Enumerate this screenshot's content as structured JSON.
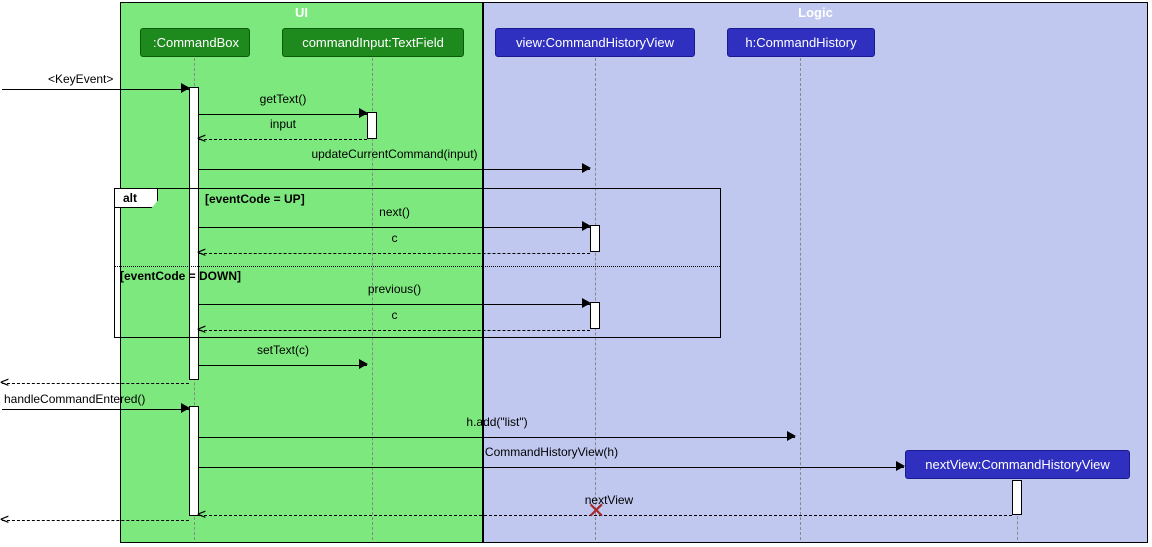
{
  "regions": {
    "ui": {
      "label": "UI"
    },
    "logic": {
      "label": "Logic"
    }
  },
  "participants": {
    "commandBox": ":CommandBox",
    "commandInput": "commandInput:TextField",
    "view": "view:CommandHistoryView",
    "history": "h:CommandHistory",
    "nextView": "nextView:CommandHistoryView"
  },
  "messages": {
    "keyEvent": "<KeyEvent>",
    "getText": "getText()",
    "inputReturn": "input",
    "updateCurrent": "updateCurrentCommand(input)",
    "next": "next()",
    "cReturn1": "c",
    "previous": "previous()",
    "cReturn2": "c",
    "setText": "setText(c)",
    "handleEntered": "handleCommandEntered()",
    "addList": "h.add(\"list\")",
    "createView": "CommandHistoryView(h)",
    "nextViewReturn": "nextView"
  },
  "alt": {
    "label": "alt",
    "guard1": "[eventCode = UP]",
    "guard2": "[eventCode = DOWN]"
  }
}
